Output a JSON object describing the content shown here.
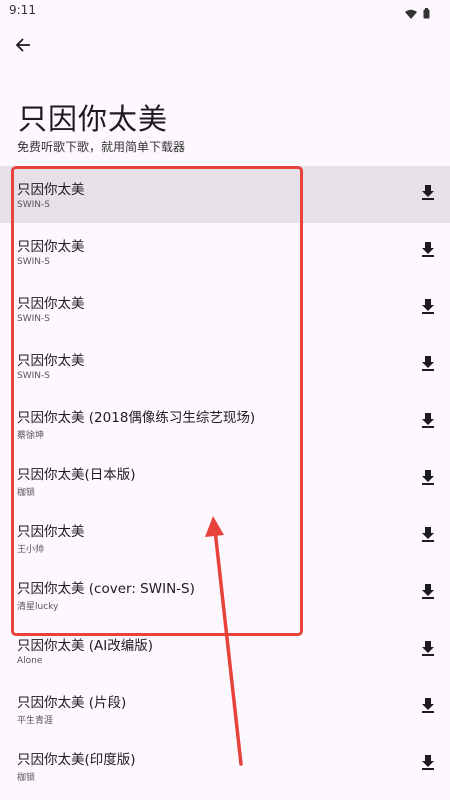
{
  "status_bar": {
    "time": "9:11"
  },
  "header": {
    "title": "只因你太美",
    "subtitle": "免费听歌下歌，就用简单下载器"
  },
  "songs": [
    {
      "title": "只因你太美",
      "artist": "SWIN-S"
    },
    {
      "title": "只因你太美",
      "artist": "SWIN-S"
    },
    {
      "title": "只因你太美",
      "artist": "SWIN-S"
    },
    {
      "title": "只因你太美",
      "artist": "SWIN-S"
    },
    {
      "title": "只因你太美 (2018偶像练习生综艺现场)",
      "artist": "蔡徐坤"
    },
    {
      "title": "只因你太美(日本版)",
      "artist": "枷锁"
    },
    {
      "title": "只因你太美",
      "artist": "王小帅"
    },
    {
      "title": "只因你太美 (cover: SWIN-S)",
      "artist": "清星lucky"
    },
    {
      "title": "只因你太美 (AI改编版)",
      "artist": "Alone"
    },
    {
      "title": "只因你太美 (片段)",
      "artist": "平生青涯"
    },
    {
      "title": "只因你太美(印度版)",
      "artist": "枷锁"
    }
  ],
  "annotation": {
    "color": "#e8433b"
  },
  "colors": {
    "background": "#fdf7fe",
    "selected_row": "#e6e0e9"
  }
}
